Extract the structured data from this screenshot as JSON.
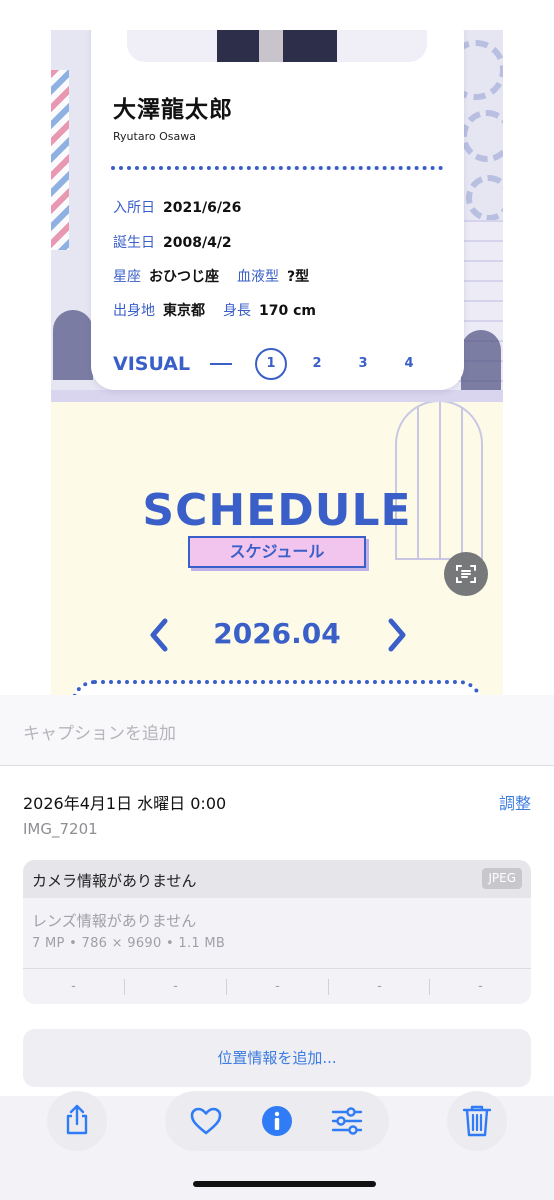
{
  "profile": {
    "name": "大澤龍太郎",
    "romaji": "Ryutaro Osawa",
    "join_label": "入所日",
    "join_value": "2021/6/26",
    "birth_label": "誕生日",
    "birth_value": "2008/4/2",
    "sign_label": "星座",
    "sign_value": "おひつじ座",
    "blood_label": "血液型",
    "blood_value": "?型",
    "home_label": "出身地",
    "home_value": "東京都",
    "height_label": "身長",
    "height_value": "170 cm",
    "visual_label": "VISUAL",
    "visual_pages": [
      "1",
      "2",
      "3",
      "4"
    ],
    "visual_active": "1"
  },
  "schedule": {
    "title": "SCHEDULE",
    "subtitle": "スケジュール",
    "month": "2026.04"
  },
  "info": {
    "caption_placeholder": "キャプションを追加",
    "datetime": "2026年4月1日 水曜日 0:00",
    "adjust": "調整",
    "filename": "IMG_7201",
    "camera": "カメラ情報がありません",
    "format_badge": "JPEG",
    "lens": "レンズ情報がありません",
    "specs": "7 MP  •  786 × 9690  •  1.1 MB",
    "exif": [
      "-",
      "-",
      "-",
      "-",
      "-"
    ],
    "location": "位置情報を追加..."
  },
  "toolbar": {
    "icons": [
      "share-icon",
      "heart-icon",
      "info-icon",
      "adjust-icon",
      "trash-icon"
    ]
  },
  "colors": {
    "accent_blue": "#3a5fc8",
    "ios_blue": "#3d7ce0",
    "pink": "#f2c5ee"
  }
}
